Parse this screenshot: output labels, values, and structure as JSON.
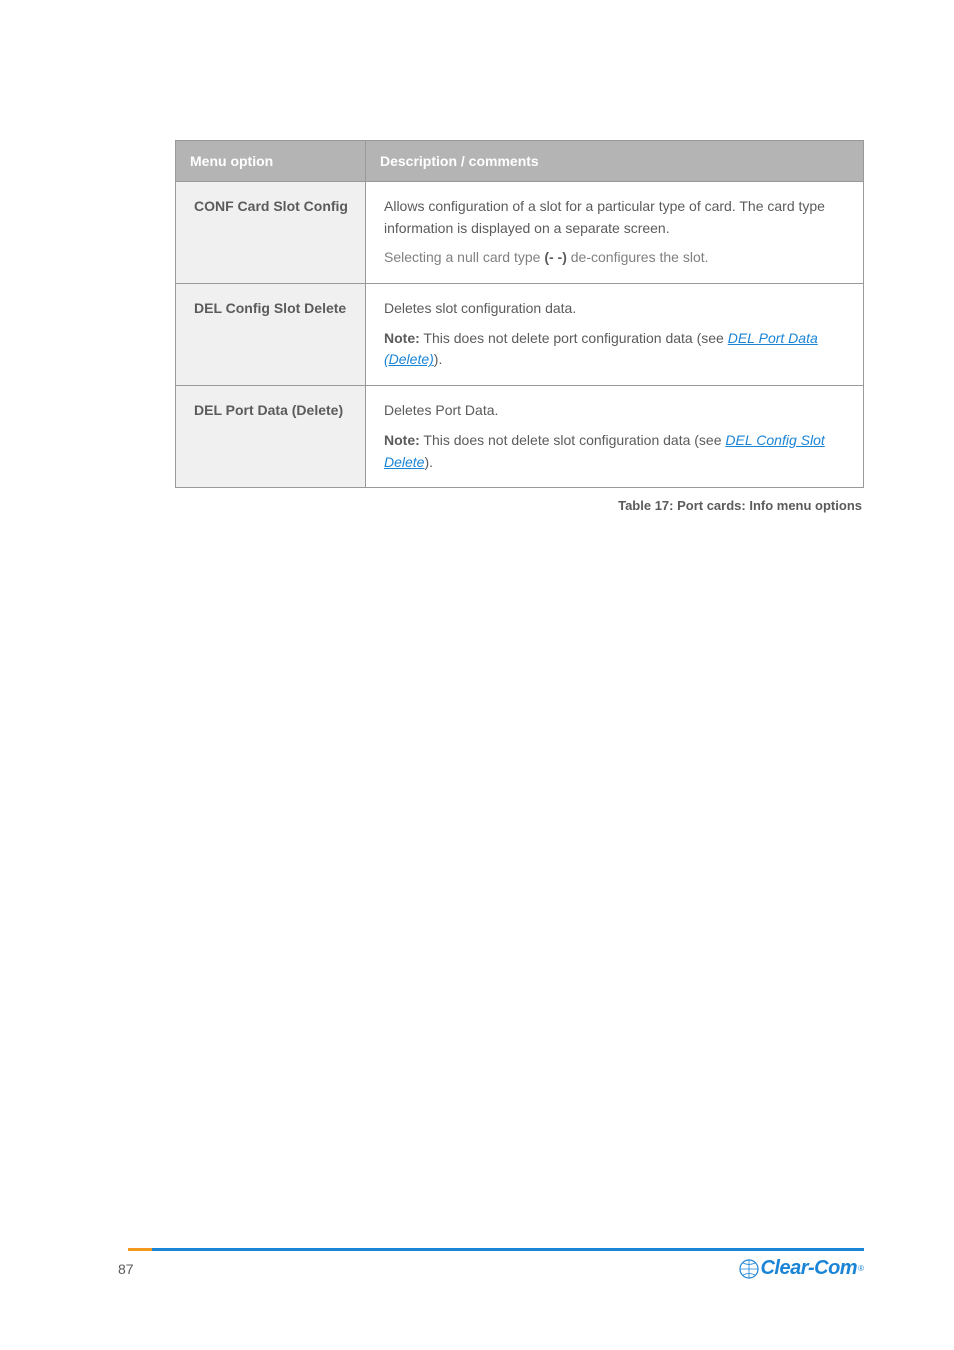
{
  "table": {
    "headers": [
      "Menu option",
      "Description / comments"
    ],
    "rows": [
      {
        "option_title": "CONF Card Slot Config",
        "desc_main": "Allows configuration of a slot for a particular type of card. The card type information is displayed on a separate screen.",
        "indent_prefix": "Selecting a null card type ",
        "indent_bold": "(- -)",
        "indent_suffix": " de-configures the slot.",
        "note": ""
      },
      {
        "option_title": "DEL Config Slot Delete",
        "desc_main": "Deletes slot configuration data.",
        "note_label": "Note:",
        "note_text": "This does not delete port configuration data (see ",
        "note_link": "DEL Port Data (Delete)",
        "note_after": ")."
      },
      {
        "option_title": "DEL Port Data (Delete)",
        "desc_main": "Deletes Port Data.",
        "note_label": "Note:",
        "note_text": "This does not delete slot configuration data (see ",
        "note_link": "DEL Config Slot Delete",
        "note_after": ")."
      }
    ]
  },
  "caption": "Table 17: Port cards: Info menu options",
  "page_number": "87",
  "logo": "Clear-Com"
}
